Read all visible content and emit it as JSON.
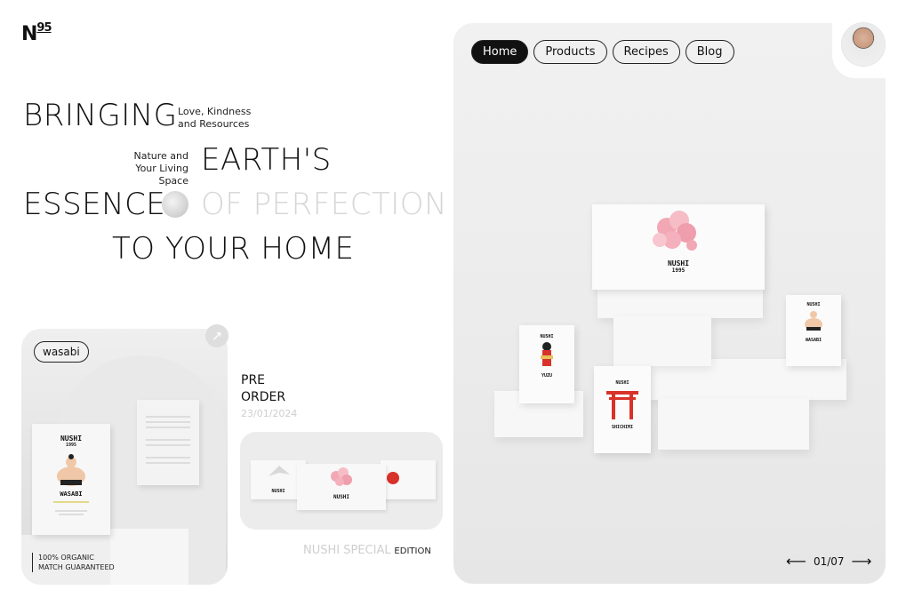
{
  "logo": {
    "main": "N",
    "sup": "95"
  },
  "headline": {
    "line1": "BRINGING",
    "note1_a": "Love, Kindness",
    "note1_b": "and Resources",
    "note2_a": "Nature and",
    "note2_b": "Your Living Space",
    "line2": "EARTH'S",
    "line3_a": "ESSENCE",
    "line3_b": "OF PERFECTION",
    "line4": "TO YOUR HOME"
  },
  "featured": {
    "tag": "wasabi",
    "arrow": "↗",
    "box_brand": "NUSHI",
    "box_year": "1995",
    "box_name": "WASABI",
    "organic_a": "100% ORGANIC",
    "organic_b": "MATCH GUARANTEED"
  },
  "preorder": {
    "line1": "PRE",
    "line2": "ORDER",
    "date": "23/01/2024",
    "box_brand": "NUSHI",
    "edition_a": "NUSHI SPECIAL",
    "edition_b": "EDITION"
  },
  "nav": [
    "Home",
    "Products",
    "Recipes",
    "Blog"
  ],
  "hero": {
    "main_brand": "NUSHI",
    "main_year": "1995",
    "yuzu": "YUZU",
    "shichimi": "SHICHIMI",
    "wasabi": "WASABI",
    "prev": "⟵",
    "counter": "01/07",
    "next": "⟶"
  },
  "colors": {
    "accent": "#111111",
    "sakura": "#f2a7b4",
    "torii": "#d8322a",
    "panel": "#ececec"
  }
}
